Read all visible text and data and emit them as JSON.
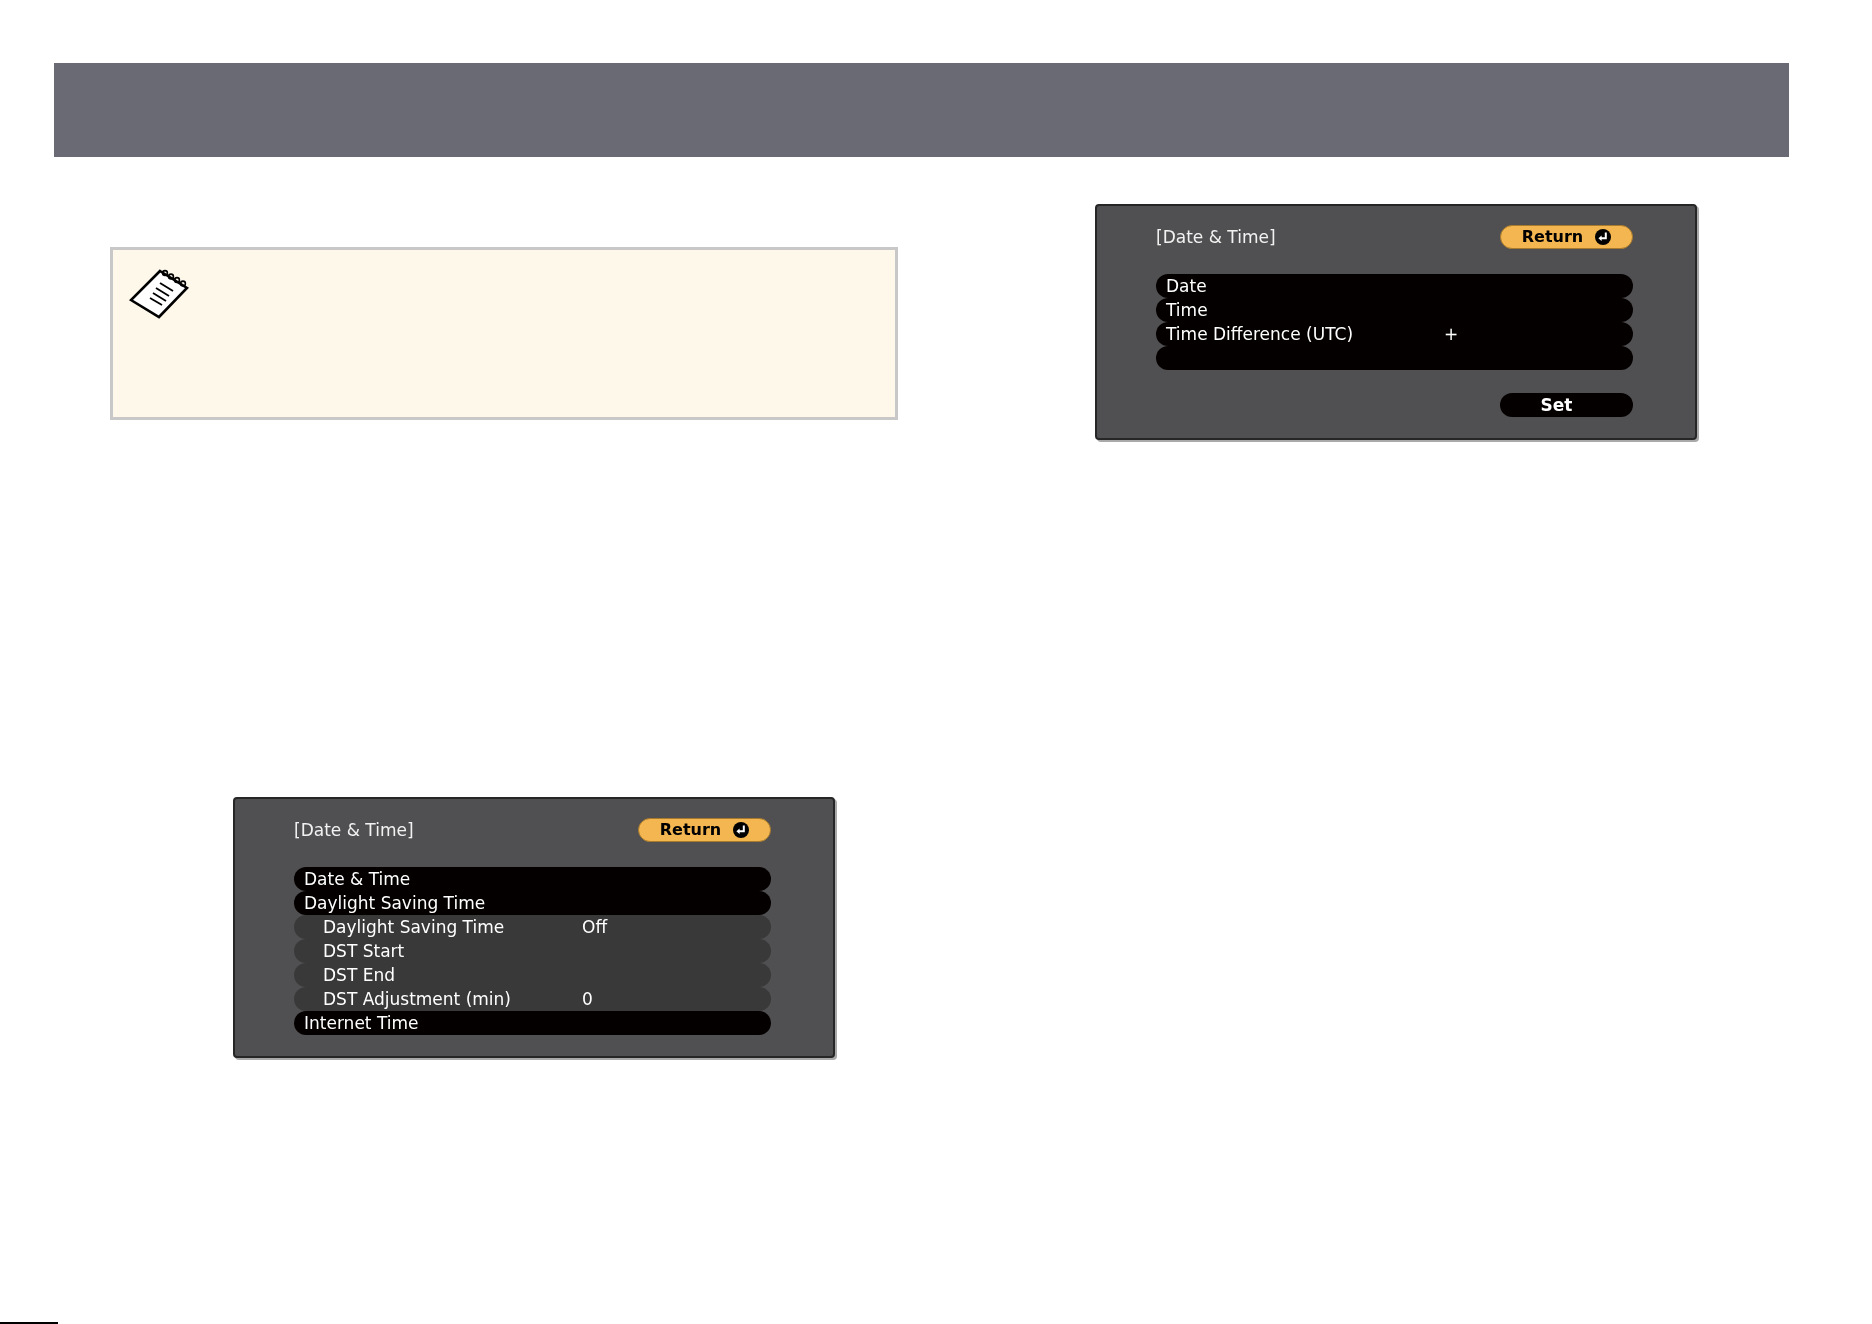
{
  "menu_screens": [
    {
      "title": "[Date & Time]",
      "return_button": "Return",
      "rows": [
        {
          "kind": "item",
          "label": "Date"
        },
        {
          "kind": "item",
          "label": "Time"
        },
        {
          "kind": "item",
          "label": "Time Difference (UTC)",
          "value": "+"
        },
        {
          "kind": "blank"
        }
      ],
      "set_button": "Set"
    },
    {
      "title": "[Date & Time]",
      "return_button": "Return",
      "rows": [
        {
          "kind": "item",
          "label": "Date & Time"
        },
        {
          "kind": "item",
          "label": "Daylight Saving Time",
          "children": [
            {
              "kind": "item",
              "label": "Daylight Saving Time",
              "value": "Off"
            },
            {
              "kind": "item",
              "label": "DST Start"
            },
            {
              "kind": "item",
              "label": "DST End"
            },
            {
              "kind": "item",
              "label": "DST Adjustment (min)",
              "value": "0"
            }
          ]
        },
        {
          "kind": "item",
          "label": "Internet Time"
        }
      ]
    }
  ]
}
